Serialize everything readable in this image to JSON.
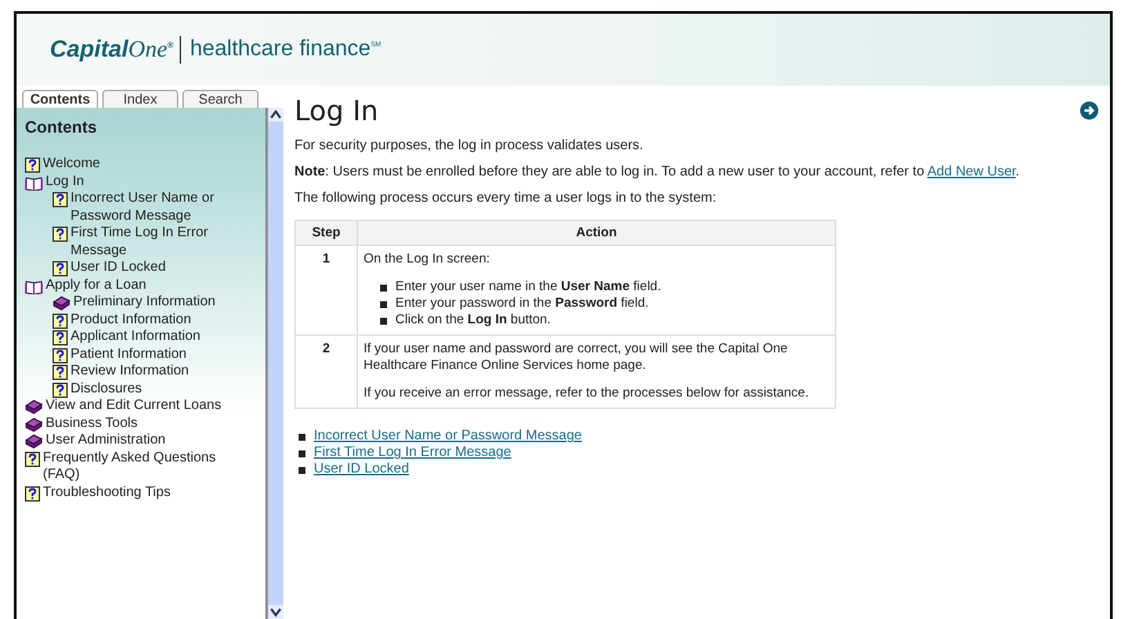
{
  "header": {
    "logo_brand": "Capital",
    "logo_script": "One",
    "logo_mark": "®",
    "logo_product": "healthcare finance",
    "logo_sm": "SM"
  },
  "tabs": [
    {
      "label": "Contents",
      "selected": true
    },
    {
      "label": "Index",
      "selected": false
    },
    {
      "label": "Search",
      "selected": false
    }
  ],
  "sidebar": {
    "title": "Contents",
    "items": [
      {
        "kind": "topic",
        "label": "Welcome"
      },
      {
        "kind": "book",
        "label": "Log In",
        "expanded": true,
        "children": [
          {
            "kind": "topic",
            "label": "Incorrect User Name or Password Message"
          },
          {
            "kind": "topic",
            "label": "First Time Log In Error Message"
          },
          {
            "kind": "topic",
            "label": "User ID Locked"
          }
        ]
      },
      {
        "kind": "book",
        "label": "Apply for a Loan",
        "expanded": true,
        "children": [
          {
            "kind": "book",
            "label": "Preliminary Information",
            "expanded": false
          },
          {
            "kind": "topic",
            "label": "Product Information"
          },
          {
            "kind": "topic",
            "label": "Applicant Information"
          },
          {
            "kind": "topic",
            "label": "Patient Information"
          },
          {
            "kind": "topic",
            "label": "Review Information"
          },
          {
            "kind": "topic",
            "label": "Disclosures"
          }
        ]
      },
      {
        "kind": "book",
        "label": "View and Edit Current Loans",
        "expanded": false
      },
      {
        "kind": "book",
        "label": "Business Tools",
        "expanded": false
      },
      {
        "kind": "book",
        "label": "User Administration",
        "expanded": false
      },
      {
        "kind": "topic",
        "label": "Frequently Asked Questions (FAQ)"
      },
      {
        "kind": "topic",
        "label": "Troubleshooting Tips"
      }
    ]
  },
  "content": {
    "title": "Log In",
    "intro": "For security purposes, the log in process validates users.",
    "note": "**Note**: Users must be enrolled before they are able to log in. To add a new user to your account, refer to",
    "note_link": "Add New User",
    "note_end": ".",
    "process": "The following process occurs every time a user logs in to the system:",
    "table": {
      "columns": [
        "Step",
        "Action"
      ],
      "rows": [
        {
          "step": "1",
          "paragraphs": [
            "On the Log In screen:"
          ],
          "bullets": [
            "Enter your user name in the **User Name** field.",
            "Enter your password in the **Password** field.",
            "Click on the **Log In** button."
          ]
        },
        {
          "step": "2",
          "paragraphs": [
            "If your user name and password are correct, you will see the Capital One Healthcare Finance Online Services home page.",
            "If you receive an error message, refer to the processes below for assistance."
          ],
          "bullets": []
        }
      ]
    },
    "links": [
      "Incorrect User Name or Password Message",
      "First Time Log In Error Message",
      "User ID Locked"
    ]
  }
}
